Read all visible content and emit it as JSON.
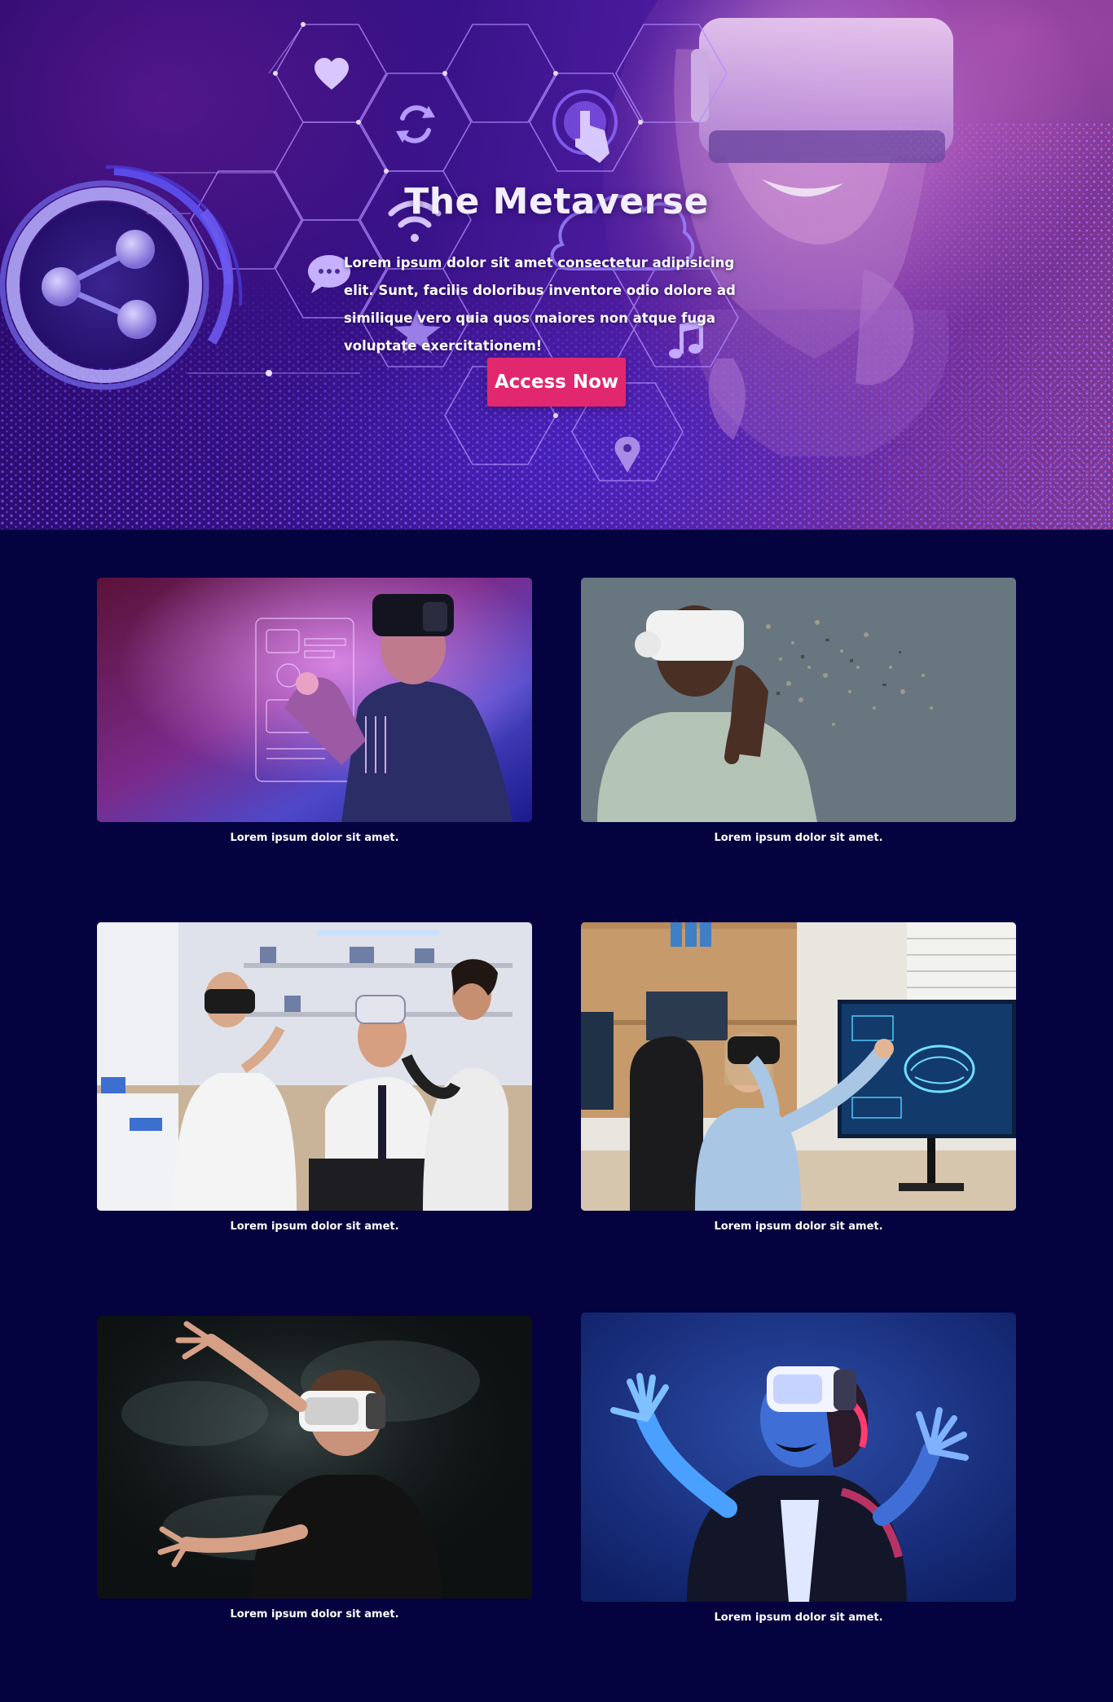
{
  "hero": {
    "title": "The Metaverse",
    "description": "Lorem ipsum dolor sit amet consectetur adipisicing elit. Sunt, facilis doloribus inventore odio dolore ad similique vero quia quos maiores non atque fuga voluptate exercitationem!",
    "cta_label": "Access Now",
    "icons": [
      "heart-icon",
      "sync-icon",
      "touch-icon",
      "wifi-icon",
      "cloud-icon",
      "chat-icon",
      "star-icon",
      "music-icon",
      "location-pin-icon",
      "share-icon"
    ],
    "colors": {
      "cta": "#e1276e",
      "background": "#361186"
    }
  },
  "gallery": {
    "background": "#04023f",
    "items": [
      {
        "caption": "Lorem ipsum dolor sit amet.",
        "photo": "man-with-vr-headset-holographic-interface"
      },
      {
        "caption": "Lorem ipsum dolor sit amet.",
        "photo": "man-in-hoodie-with-vr-headset-particles"
      },
      {
        "caption": "Lorem ipsum dolor sit amet.",
        "photo": "scientists-in-lab-with-vr-headset"
      },
      {
        "caption": "Lorem ipsum dolor sit amet.",
        "photo": "woman-with-vr-headset-brain-scan-screen"
      },
      {
        "caption": "Lorem ipsum dolor sit amet.",
        "photo": "boy-with-vr-headset-in-smoke"
      },
      {
        "caption": "Lorem ipsum dolor sit amet.",
        "photo": "woman-with-vr-headset-neon-blue"
      }
    ]
  }
}
